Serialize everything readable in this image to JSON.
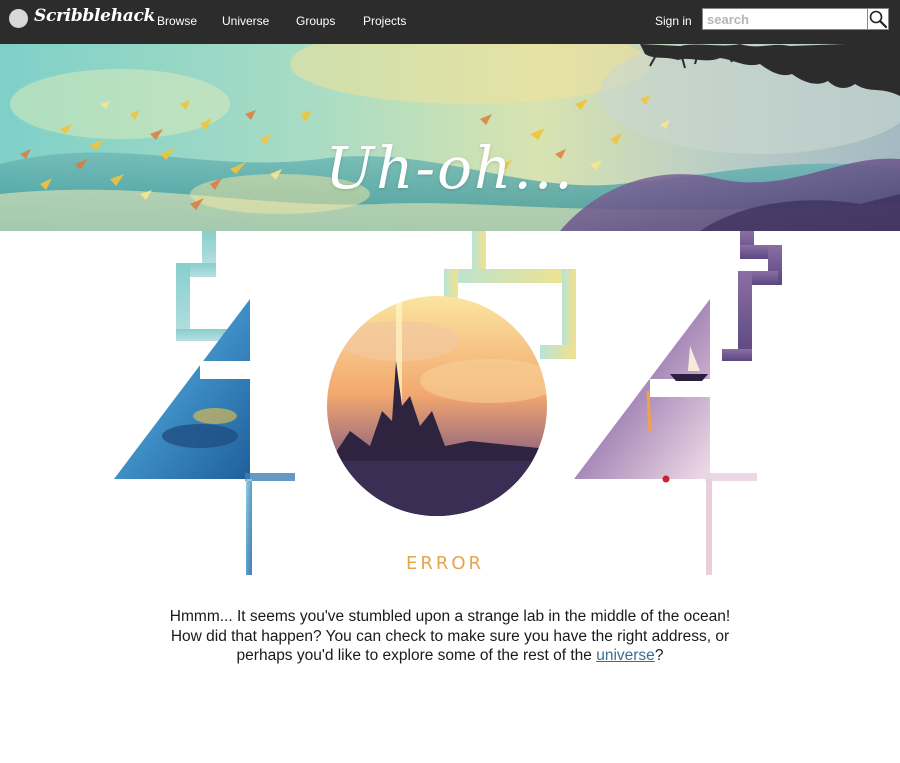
{
  "app": {
    "brand": "Scribblehack"
  },
  "nav": {
    "links": [
      "Browse",
      "Universe",
      "Groups",
      "Projects"
    ],
    "signin_label": "Sign in",
    "search_placeholder": "search"
  },
  "banner": {
    "title": "Uh-oh..."
  },
  "art": {
    "error_label": "ERROR"
  },
  "message": {
    "line1": "Hmmm... It seems you've stumbled upon a strange lab in the middle of the ocean!",
    "line2": "How did that happen? You can check to make sure you have the right address, or",
    "line3_before": "perhaps you'd like to explore some of the rest of the ",
    "link_label": "universe",
    "line3_after": "?"
  },
  "colors": {
    "nav_bg": "#2c2c2c",
    "link": "#3a6e8f",
    "error": "#e8a44a"
  }
}
